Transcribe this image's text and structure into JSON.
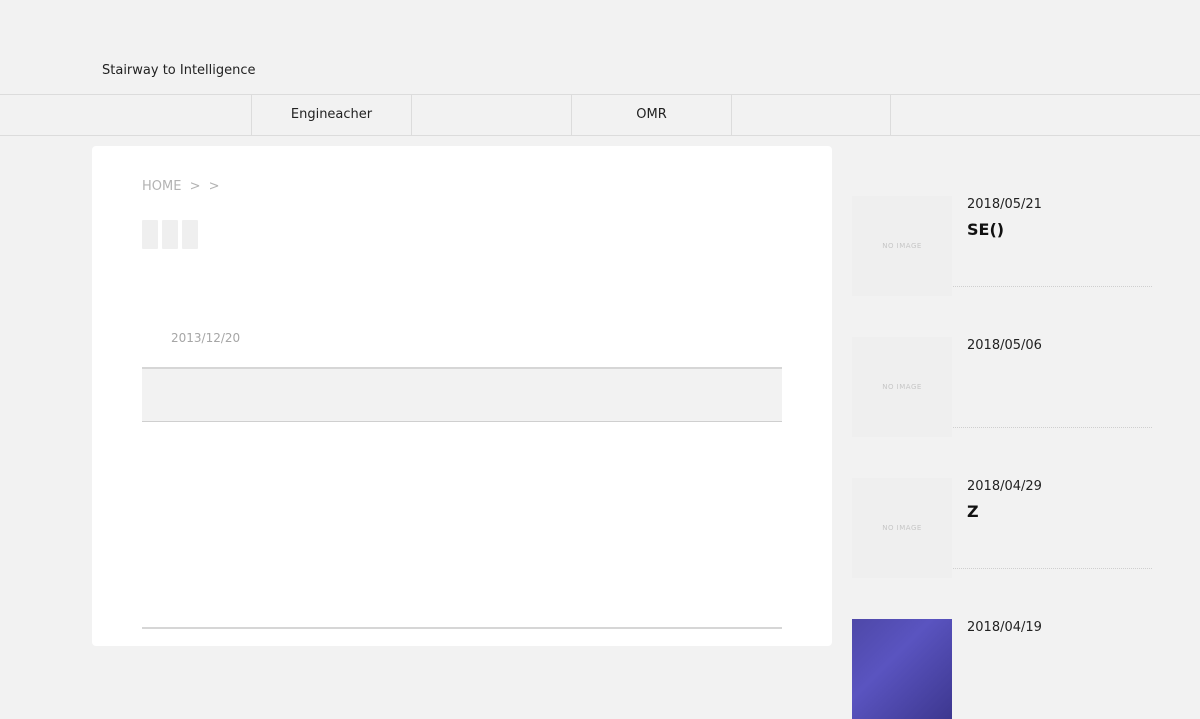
{
  "header": {
    "site_title": "Stairway to Intelligence"
  },
  "nav": {
    "items": [
      {
        "label": "Engineacher"
      },
      {
        "label": ""
      },
      {
        "label": "OMR"
      },
      {
        "label": ""
      }
    ]
  },
  "main": {
    "breadcrumb": {
      "home": "HOME",
      "sep1": ">",
      "sep2": ">"
    },
    "share_buttons": [
      "",
      "",
      ""
    ],
    "post": {
      "date": "2013/12/20",
      "title": ""
    }
  },
  "sidebar": {
    "posts": [
      {
        "date": "2018/05/21",
        "title": "SE()",
        "thumb": "NO IMAGE"
      },
      {
        "date": "2018/05/06",
        "title": "",
        "thumb": "NO IMAGE"
      },
      {
        "date": "2018/04/29",
        "title": "Z",
        "thumb": "NO IMAGE"
      },
      {
        "date": "2018/04/19",
        "title": "",
        "thumb": ""
      }
    ]
  }
}
